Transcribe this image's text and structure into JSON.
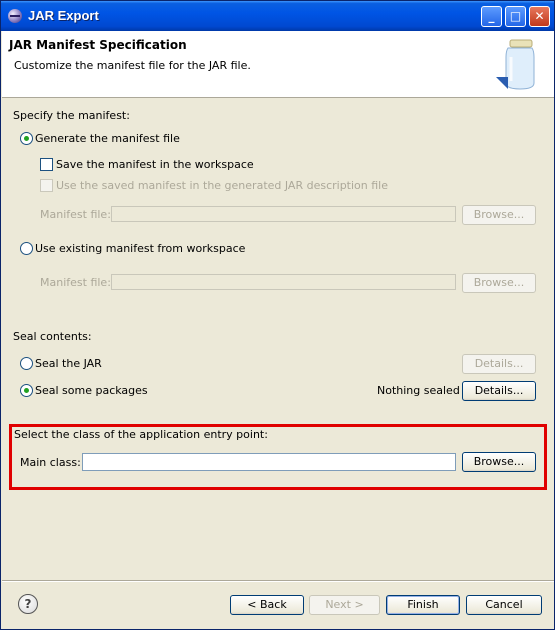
{
  "window": {
    "title": "JAR Export"
  },
  "header": {
    "title": "JAR Manifest Specification",
    "description": "Customize the manifest file for the JAR file."
  },
  "manifest": {
    "section_label": "Specify the manifest:",
    "generate_label": "Generate the manifest file",
    "save_label": "Save the manifest in the workspace",
    "use_saved_label": "Use the saved manifest in the generated JAR description file",
    "manifest_file_label": "Manifest file:",
    "browse_label": "Browse...",
    "use_existing_label": "Use existing manifest from workspace",
    "manifest_file_label2": "Manifest file:",
    "browse_label2": "Browse..."
  },
  "seal": {
    "section_label": "Seal contents:",
    "seal_jar_label": "Seal the JAR",
    "details_label": "Details...",
    "seal_some_label": "Seal some packages",
    "status": "Nothing sealed",
    "details_label2": "Details..."
  },
  "entry": {
    "section_label": "Select the class of the application entry point:",
    "main_class_label": "Main class:",
    "main_class_value": "",
    "browse_label": "Browse..."
  },
  "footer": {
    "help_icon": "?",
    "back_label": "< Back",
    "next_label": "Next >",
    "finish_label": "Finish",
    "cancel_label": "Cancel"
  },
  "colors": {
    "highlight": "#e00000",
    "titlebar": "#0055e5"
  },
  "icons": [
    "eclipse-icon",
    "minimize-icon",
    "maximize-icon",
    "close-icon",
    "jar-icon",
    "help-icon"
  ]
}
